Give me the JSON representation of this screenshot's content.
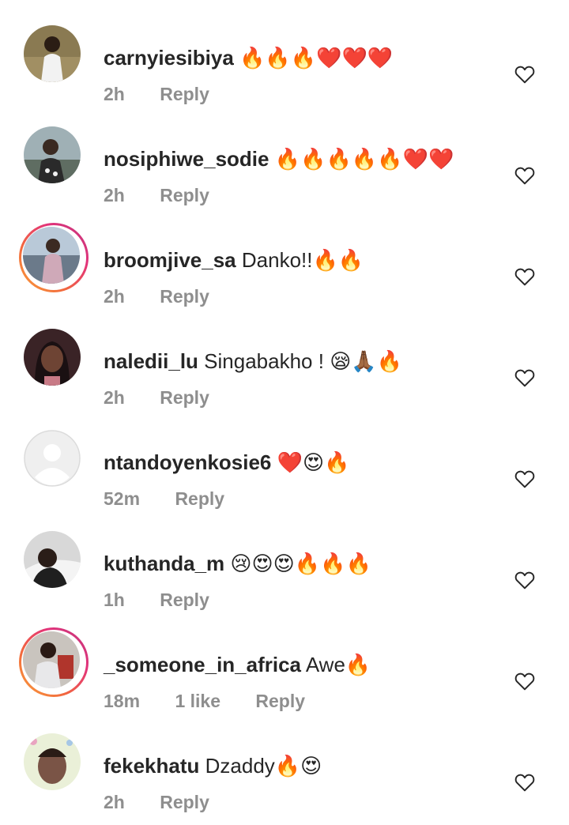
{
  "colors": {
    "text_primary": "#262626",
    "text_secondary": "#8e8e8e",
    "story_ring_start": "#f9a23a",
    "story_ring_end": "#c0397d",
    "emoji_red_heart": "#e0242e"
  },
  "comments": [
    {
      "username": "carnyiesibiya",
      "text": "",
      "emoji": "🔥🔥🔥❤️❤️❤️",
      "time": "2h",
      "likes": "",
      "reply_label": "Reply",
      "has_story": false,
      "avatar_icon": "avatar-icon",
      "like_icon": "heart-outline-icon"
    },
    {
      "username": "nosiphiwe_sodie",
      "text": "",
      "emoji": "🔥🔥🔥🔥🔥❤️❤️",
      "time": "2h",
      "likes": "",
      "reply_label": "Reply",
      "has_story": false,
      "avatar_icon": "avatar-icon",
      "like_icon": "heart-outline-icon"
    },
    {
      "username": "broomjive_sa",
      "text": "Danko!!",
      "emoji": "🔥🔥",
      "time": "2h",
      "likes": "",
      "reply_label": "Reply",
      "has_story": true,
      "avatar_icon": "avatar-icon",
      "like_icon": "heart-outline-icon"
    },
    {
      "username": "naledii_lu",
      "text": "Singabakho !",
      "emoji": "😪🙏🏾🔥",
      "time": "2h",
      "likes": "",
      "reply_label": "Reply",
      "has_story": false,
      "avatar_icon": "avatar-icon",
      "like_icon": "heart-outline-icon"
    },
    {
      "username": "ntandoyenkosie6",
      "text": "",
      "emoji": "❤️😍🔥",
      "time": "52m",
      "likes": "",
      "reply_label": "Reply",
      "has_story": false,
      "avatar_icon": "default-avatar-icon",
      "like_icon": "heart-outline-icon"
    },
    {
      "username": "kuthanda_m",
      "text": "",
      "emoji": "😢😍😍🔥🔥🔥",
      "time": "1h",
      "likes": "",
      "reply_label": "Reply",
      "has_story": false,
      "avatar_icon": "avatar-icon",
      "like_icon": "heart-outline-icon"
    },
    {
      "username": "_someone_in_africa",
      "text": "Awe",
      "emoji": "🔥",
      "time": "18m",
      "likes": "1 like",
      "reply_label": "Reply",
      "has_story": true,
      "avatar_icon": "avatar-icon",
      "like_icon": "heart-outline-icon"
    },
    {
      "username": "fekekhatu",
      "text": "Dzaddy",
      "emoji": "🔥😍",
      "time": "2h",
      "likes": "",
      "reply_label": "Reply",
      "has_story": false,
      "avatar_icon": "avatar-icon",
      "like_icon": "heart-outline-icon"
    }
  ]
}
